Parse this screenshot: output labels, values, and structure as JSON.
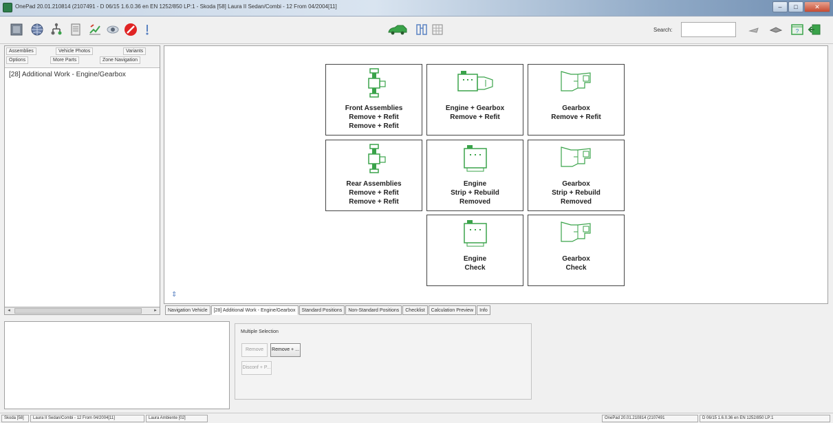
{
  "window": {
    "title": "OnePad 20.01.210814 (2107491 - D 06/15 1.6.0.36 en EN 1252/850 LP:1 - Skoda [58] Laura II Sedan/Combi - 12 From 04/2004[11]",
    "controls": {
      "minimize": "–",
      "maximize": "□",
      "close": "✕"
    }
  },
  "toolbar": {
    "left_icons": [
      "grid-icon",
      "globe-icon",
      "tree-icon",
      "document-icon",
      "edit-chart-icon",
      "eye-icon",
      "no-entry-icon",
      "info-icon"
    ],
    "center_icons": [
      "car-icon",
      "binoculars-icon",
      "table-icon"
    ],
    "search_label": "Search:",
    "search_value": "",
    "right_icons": [
      "pen-icon",
      "hat-icon",
      "help-window-icon",
      "exit-icon"
    ]
  },
  "left_panel": {
    "tabs": [
      "Assemblies",
      "Vehicle Photos",
      "Variants",
      "Options",
      "More Parts",
      "Zone Navigation"
    ],
    "tree_item": "[28] Additional Work - Engine/Gearbox",
    "scroll_left": "◂",
    "scroll_right": "▸"
  },
  "tiles": [
    {
      "name": "front-assemblies",
      "icon": "assembly-icon",
      "lines": [
        "Front Assemblies",
        "Remove + Refit",
        "Remove + Refit"
      ]
    },
    {
      "name": "engine-gearbox",
      "icon": "engine-gearbox-icon",
      "lines": [
        "Engine + Gearbox",
        "Remove + Refit"
      ]
    },
    {
      "name": "gearbox",
      "icon": "gearbox-icon",
      "lines": [
        "Gearbox",
        "Remove + Refit"
      ]
    },
    {
      "name": "rear-assemblies",
      "icon": "assembly-icon",
      "lines": [
        "Rear Assemblies",
        "Remove + Refit",
        "Remove + Refit"
      ]
    },
    {
      "name": "engine-strip",
      "icon": "engine-icon",
      "lines": [
        "Engine",
        "Strip + Rebuild",
        "Removed"
      ]
    },
    {
      "name": "gearbox-strip",
      "icon": "gearbox-icon",
      "lines": [
        "Gearbox",
        "Strip + Rebuild",
        "Removed"
      ]
    },
    {
      "name": "engine-check",
      "icon": "engine-icon",
      "lines": [
        "Engine",
        "Check"
      ]
    },
    {
      "name": "gearbox-check",
      "icon": "gearbox-icon",
      "lines": [
        "Gearbox",
        "Check"
      ]
    }
  ],
  "canvas_handle": "⇕",
  "bottom_tabs": [
    {
      "label": "Navigation Vehicle",
      "active": false
    },
    {
      "label": "[28] Additional Work - Engine/Gearbox",
      "active": true
    },
    {
      "label": "Standard Positions",
      "active": false
    },
    {
      "label": "Non-Standard Positions",
      "active": false
    },
    {
      "label": "Checklist",
      "active": false
    },
    {
      "label": "Calculation Preview",
      "active": false
    },
    {
      "label": "Info",
      "active": false
    }
  ],
  "multiple_selection": {
    "label": "Multiple Selection",
    "buttons": [
      {
        "label": "Remove",
        "enabled": false
      },
      {
        "label": "Remove + ...",
        "enabled": true
      },
      {
        "label": "Disconf + P...",
        "enabled": false
      }
    ]
  },
  "status_bar": {
    "make": "Skoda [58]",
    "model": "Laura II Sedan/Combi - 12 From 04/2004[11]",
    "trim": "Laura Ambiente [02]",
    "version": "OnePad 20.01.210814 (2107491",
    "data_version": "D 06/15 1.6.0.36 en EN 1252/850 LP:1"
  },
  "colors": {
    "icon_green": "#3aa34a",
    "tile_border": "#444444",
    "title_gradient_end": "#6f8db1"
  }
}
